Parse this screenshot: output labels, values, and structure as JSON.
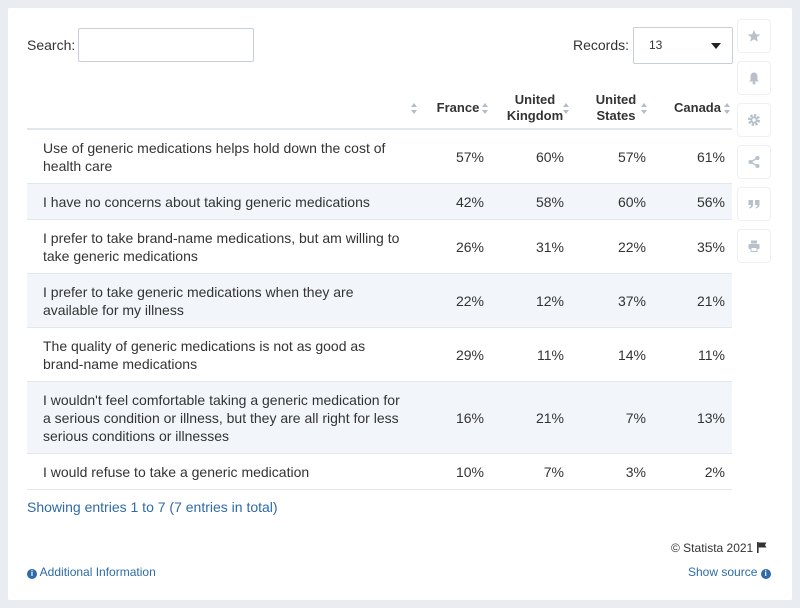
{
  "search": {
    "label": "Search:",
    "value": ""
  },
  "records": {
    "label": "Records:",
    "value": "13"
  },
  "chart_data": {
    "type": "table",
    "columns": [
      "",
      "France",
      "United Kingdom",
      "United States",
      "Canada"
    ],
    "rows": [
      {
        "label": "Use of generic medications helps hold down the cost of health care",
        "values": [
          "57%",
          "60%",
          "57%",
          "61%"
        ]
      },
      {
        "label": "I have no concerns about taking generic medications",
        "values": [
          "42%",
          "58%",
          "60%",
          "56%"
        ]
      },
      {
        "label": "I prefer to take brand-name medications, but am willing to take generic medications",
        "values": [
          "26%",
          "31%",
          "22%",
          "35%"
        ]
      },
      {
        "label": "I prefer to take generic medications when they are available for my illness",
        "values": [
          "22%",
          "12%",
          "37%",
          "21%"
        ]
      },
      {
        "label": "The quality of generic medications is not as good as brand-name medications",
        "values": [
          "29%",
          "11%",
          "14%",
          "11%"
        ]
      },
      {
        "label": "I wouldn't feel comfortable taking a generic medication for a serious condition or illness, but they are all right for less serious conditions or illnesses",
        "values": [
          "16%",
          "21%",
          "7%",
          "13%"
        ]
      },
      {
        "label": "I would refuse to take a generic medication",
        "values": [
          "10%",
          "7%",
          "3%",
          "2%"
        ]
      }
    ]
  },
  "footer": {
    "entries_text": "Showing entries 1 to 7 (7 entries in total)",
    "copyright": "© Statista 2021",
    "additional_info": "Additional Information",
    "show_source": "Show source"
  },
  "sidebar_icons": [
    "star-icon",
    "bell-icon",
    "gear-icon",
    "share-icon",
    "quote-icon",
    "print-icon"
  ],
  "colors": {
    "link": "#2e6ba8",
    "row_alt": "#f2f5f9",
    "background": "#e9edf2"
  }
}
